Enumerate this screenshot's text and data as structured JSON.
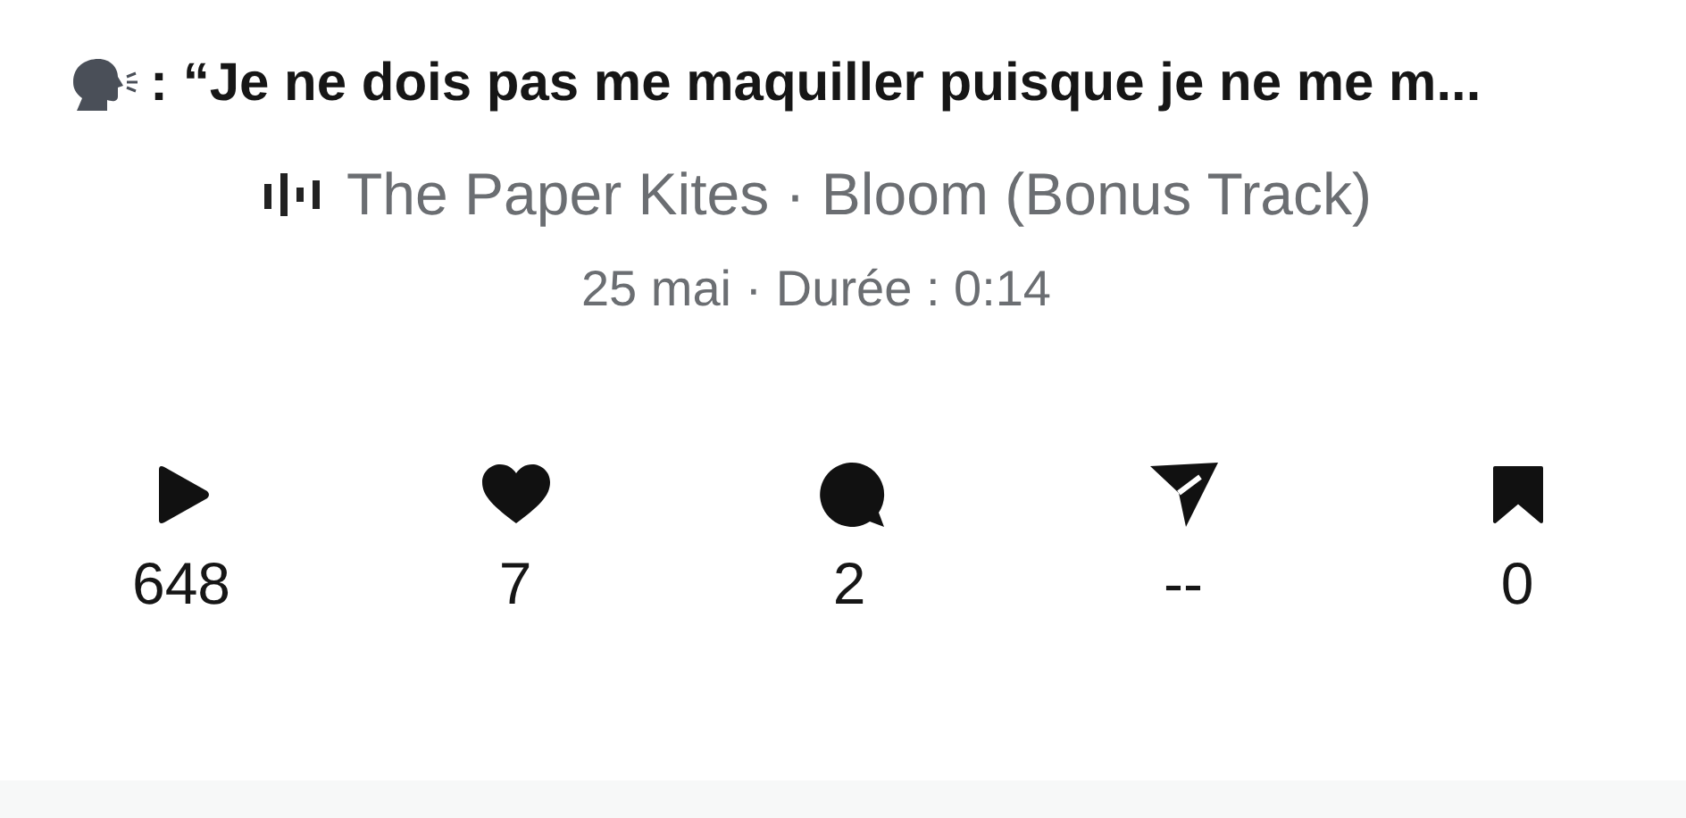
{
  "post": {
    "title": ": “Je ne dois pas me maquiller puisque je ne me m...",
    "sound": "The Paper Kites · Bloom (Bonus Track)",
    "meta": "25 mai · Durée : 0:14"
  },
  "stats": [
    {
      "kind": "play",
      "count": "648"
    },
    {
      "kind": "like",
      "count": "7"
    },
    {
      "kind": "comment",
      "count": "2"
    },
    {
      "kind": "share",
      "count": "--"
    },
    {
      "kind": "save",
      "count": "0"
    }
  ]
}
